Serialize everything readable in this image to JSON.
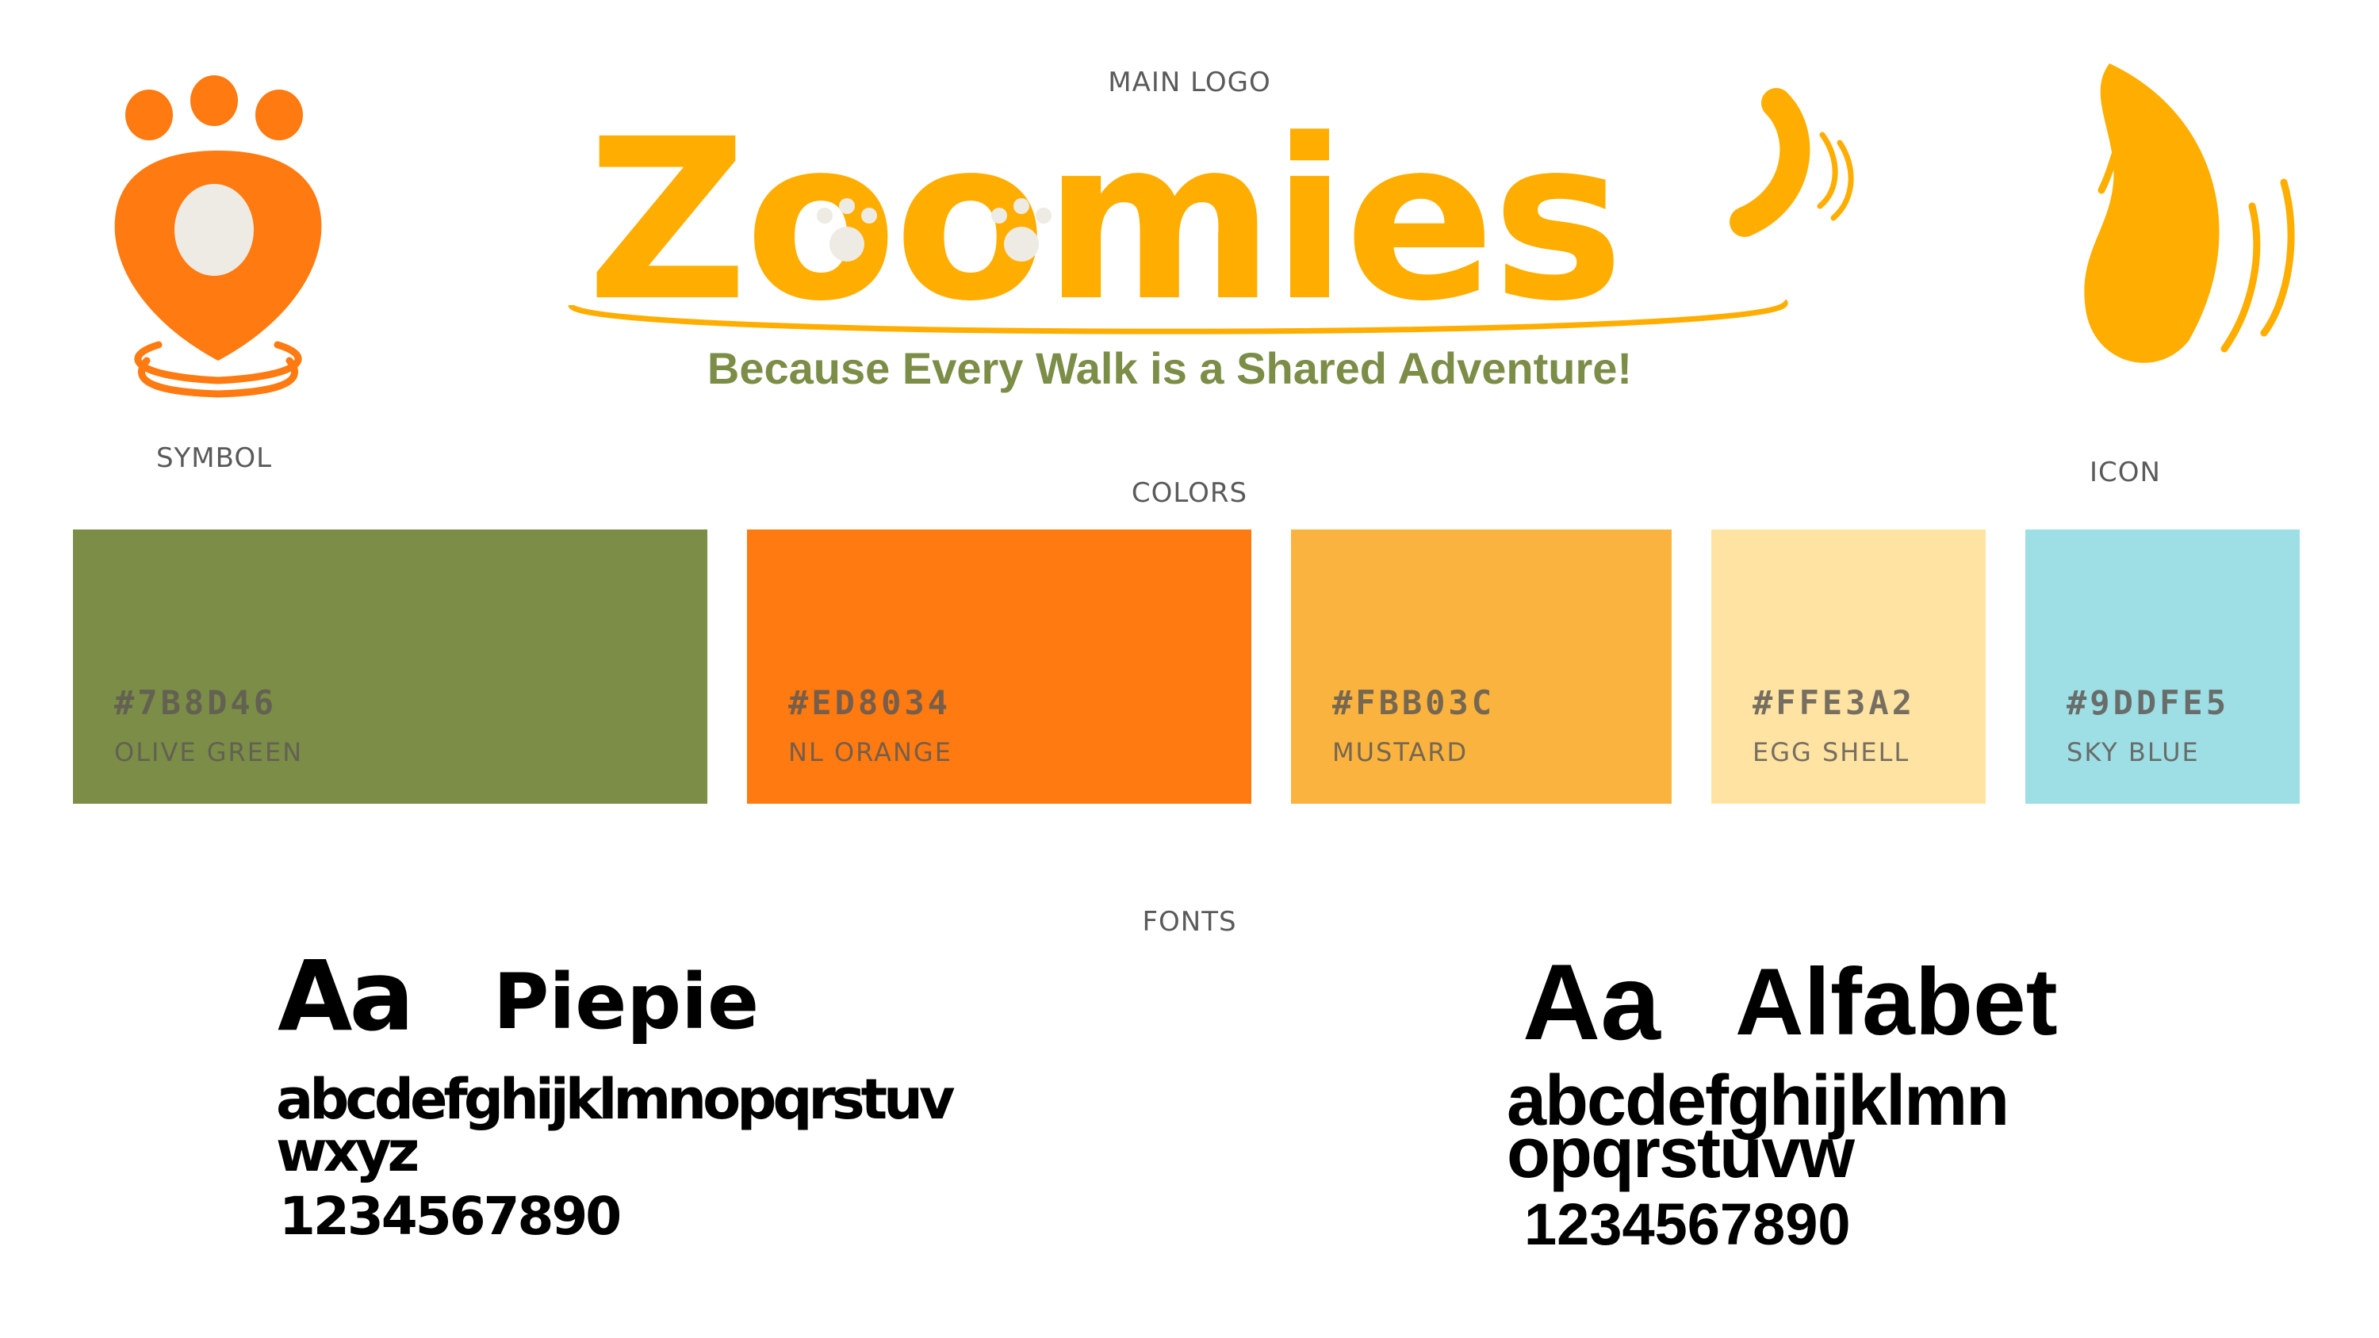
{
  "labels": {
    "main_logo": "MAIN LOGO",
    "symbol": "SYMBOL",
    "icon": "ICON",
    "colors": "COLORS",
    "fonts": "FONTS"
  },
  "logo": {
    "wordmark": "Zoomies",
    "tagline": "Because Every Walk is a Shared Adventure!"
  },
  "colors": [
    {
      "hex": "#7B8D46",
      "name": "OLIVE GREEN"
    },
    {
      "hex": "#ED8034",
      "name": "NL ORANGE"
    },
    {
      "hex": "#FBB03C",
      "name": "MUSTARD"
    },
    {
      "hex": "#FFE3A2",
      "name": "EGG SHELL"
    },
    {
      "hex": "#9DDFE5",
      "name": "SKY BLUE"
    }
  ],
  "fonts": [
    {
      "sample": "Aa",
      "name": "Piepie",
      "lower_line1": "abcdefghijklmnopqrstuv",
      "lower_line2": "wxyz",
      "digits": "1234567890"
    },
    {
      "sample": "Aa",
      "name": "Alfabet",
      "lower_line1": "abcdefghijklmn",
      "lower_line2": "opqrstuvw",
      "digits": "1234567890"
    }
  ],
  "brand_colors": {
    "logo_yellow": "#FFAE00",
    "symbol_orange": "#FF7A10",
    "paw_cream": "#EEEAE4"
  }
}
